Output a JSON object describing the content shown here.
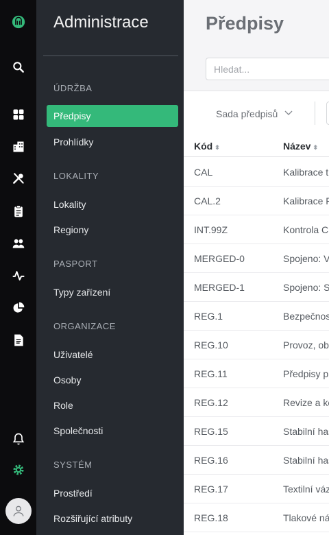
{
  "colors": {
    "rail_bg": "#0c0c0e",
    "sidebar_bg": "#262a30",
    "accent": "#34b97a"
  },
  "rail_icons": [
    "logo-icon",
    "search-icon",
    "dashboard-icon",
    "buildings-icon",
    "tools-icon",
    "clipboard-icon",
    "people-icon",
    "activity-icon",
    "pie-chart-icon",
    "report-icon",
    "bell-icon",
    "gear-icon",
    "user-icon"
  ],
  "sidebar": {
    "title": "Administrace",
    "sections": [
      {
        "label": "ÚDRŽBA",
        "items": [
          "Předpisy",
          "Prohlídky"
        ]
      },
      {
        "label": "LOKALITY",
        "items": [
          "Lokality",
          "Regiony"
        ]
      },
      {
        "label": "PASPORT",
        "items": [
          "Typy zařízení"
        ]
      },
      {
        "label": "ORGANIZACE",
        "items": [
          "Uživatelé",
          "Osoby",
          "Role",
          "Společnosti"
        ]
      },
      {
        "label": "SYSTÉM",
        "items": [
          "Prostředí",
          "Rozšiřující atributy"
        ]
      }
    ],
    "active_item": "Předpisy"
  },
  "main": {
    "title": "Předpisy",
    "search_placeholder": "Hledat...",
    "filter_label": "Sada předpisů",
    "columns": [
      "Kód",
      "Název"
    ],
    "rows": [
      [
        "CAL",
        "Kalibrace t"
      ],
      [
        "CAL.2",
        "Kalibrace P"
      ],
      [
        "INT.99Z",
        "Kontrola C("
      ],
      [
        "MERGED-0",
        "Spojeno: V"
      ],
      [
        "MERGED-1",
        "Spojeno: S"
      ],
      [
        "REG.1",
        "Bezpečnos"
      ],
      [
        "REG.10",
        "Provoz, ob"
      ],
      [
        "REG.11",
        "Předpisy p"
      ],
      [
        "REG.12",
        "Revize a kc"
      ],
      [
        "REG.15",
        "Stabilní has"
      ],
      [
        "REG.16",
        "Stabilní has"
      ],
      [
        "REG.17",
        "Textilní váz"
      ],
      [
        "REG.18",
        "Tlakové ná"
      ]
    ]
  }
}
